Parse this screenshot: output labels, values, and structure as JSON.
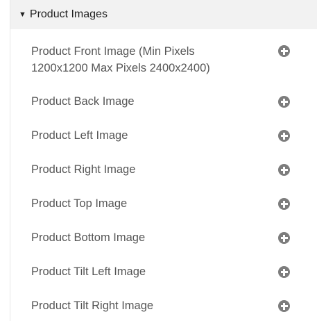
{
  "section": {
    "title": "Product Images",
    "expanded_icon": "caret-down-icon",
    "add_icon": "plus-circle-icon",
    "items": [
      {
        "label": "Product Front Image (Min Pixels 1200x1200 Max Pixels 2400x2400)"
      },
      {
        "label": "Product Back Image"
      },
      {
        "label": "Product Left Image"
      },
      {
        "label": "Product Right Image"
      },
      {
        "label": "Product Top Image"
      },
      {
        "label": "Product Bottom Image"
      },
      {
        "label": "Product Tilt Left Image"
      },
      {
        "label": "Product Tilt Right Image"
      }
    ]
  }
}
